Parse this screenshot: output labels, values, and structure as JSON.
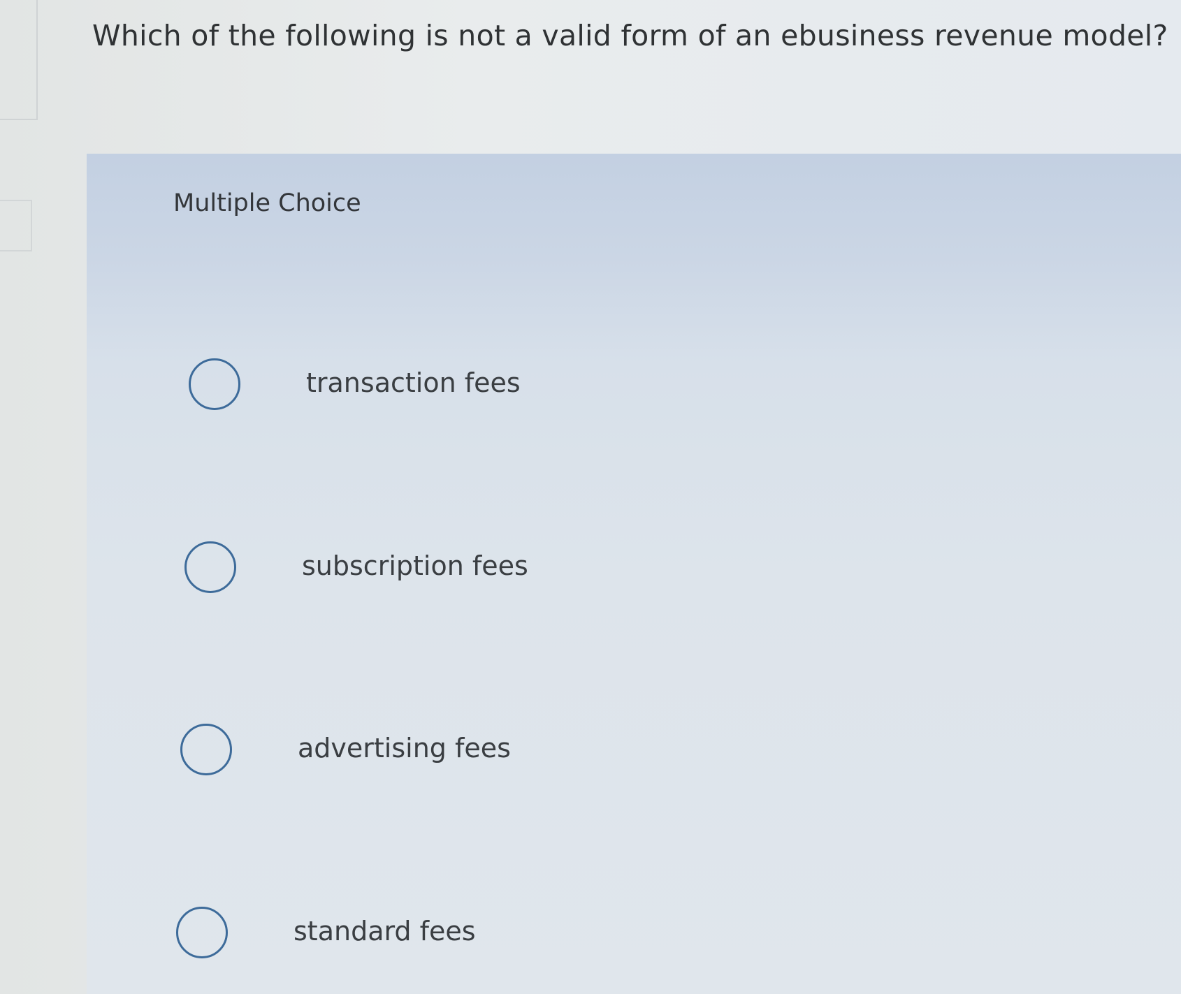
{
  "question": {
    "text": "Which of the following is not a valid form of an ebusiness revenue model?"
  },
  "answer_area": {
    "type_label": "Multiple Choice",
    "options": [
      {
        "label": "transaction fees",
        "selected": false
      },
      {
        "label": "subscription fees",
        "selected": false
      },
      {
        "label": "advertising fees",
        "selected": false
      },
      {
        "label": "standard fees",
        "selected": false
      }
    ]
  },
  "colors": {
    "radio_border": "#3d6b9a",
    "text": "#3a3e42",
    "panel_tint": "#c3d0e2"
  }
}
